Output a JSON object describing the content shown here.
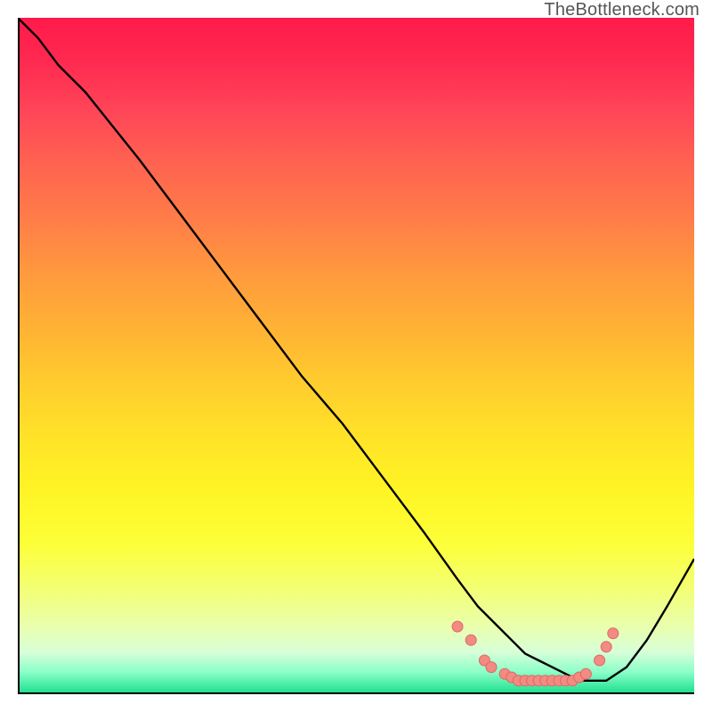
{
  "watermark": "TheBottleneck.com",
  "chart_data": {
    "type": "line",
    "title": "",
    "xlabel": "",
    "ylabel": "",
    "xlim": [
      0,
      100
    ],
    "ylim": [
      0,
      100
    ],
    "grid": false,
    "series": [
      {
        "name": "curve",
        "x": [
          0,
          3,
          6,
          10,
          14,
          18,
          24,
          30,
          36,
          42,
          48,
          54,
          60,
          65,
          68,
          71,
          73,
          75,
          77,
          79,
          81,
          83,
          85,
          87,
          90,
          93,
          96,
          100
        ],
        "y": [
          100,
          97,
          93,
          89,
          84,
          79,
          71,
          63,
          55,
          47,
          40,
          32,
          24,
          17,
          13,
          10,
          8,
          6,
          5,
          4,
          3,
          2,
          2,
          2,
          4,
          8,
          13,
          20
        ]
      }
    ],
    "markers": {
      "x": [
        65,
        67,
        69,
        70,
        72,
        73,
        74,
        75,
        76,
        77,
        78,
        79,
        80,
        81,
        82,
        83,
        84,
        86,
        87,
        88
      ],
      "y": [
        10,
        8,
        5,
        4,
        3,
        2.5,
        2,
        2,
        2,
        2,
        2,
        2,
        2,
        2,
        2,
        2.5,
        3,
        5,
        7,
        9
      ]
    }
  },
  "colors": {
    "line": "#000000",
    "marker_fill": "#f28b82",
    "marker_stroke": "#e06666"
  }
}
